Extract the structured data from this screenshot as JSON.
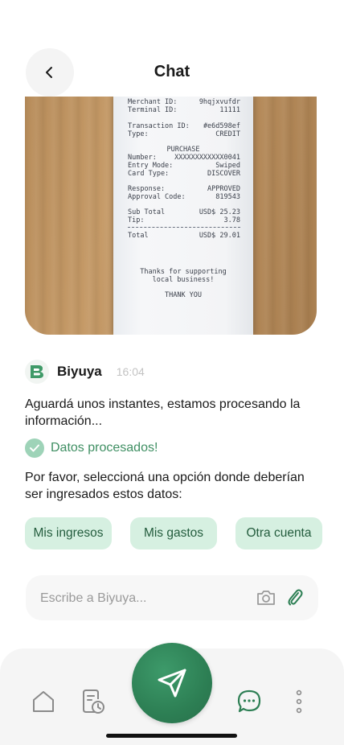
{
  "header": {
    "title": "Chat"
  },
  "receipt": {
    "lines": [
      [
        "Merchant ID:",
        "9hqjxvufdr"
      ],
      [
        "Terminal ID:",
        "11111"
      ],
      [
        "Transaction ID:",
        "#e6d598ef"
      ],
      [
        "Type:",
        "CREDIT"
      ],
      [
        "Number:",
        "XXXXXXXXXXXX0041"
      ],
      [
        "Entry Mode:",
        "Swiped"
      ],
      [
        "Card Type:",
        "DISCOVER"
      ],
      [
        "Response:",
        "APPROVED"
      ],
      [
        "Approval Code:",
        "819543"
      ],
      [
        "Sub Total",
        "USD$ 25.23"
      ],
      [
        "Tip:",
        "3.78"
      ],
      [
        "Total",
        "USD$ 29.01"
      ]
    ],
    "purchase_heading": "PURCHASE",
    "thanks_line1": "Thanks for supporting",
    "thanks_line2": "local business!",
    "thank_you": "THANK YOU"
  },
  "message": {
    "sender": "Biyuya",
    "time": "16:04",
    "processing_text": "Aguardá unos instantes, estamos procesando la información...",
    "processed_text": "Datos procesados!",
    "prompt_text": "Por favor, seleccioná una opción donde deberían ser ingresados estos datos:"
  },
  "options": {
    "income": "Mis ingresos",
    "expenses": "Mis gastos",
    "other_account": "Otra cuenta"
  },
  "composer": {
    "placeholder": "Escribe a Biyuya..."
  },
  "nav": {
    "icons": [
      "home-icon",
      "history-icon",
      "send-icon",
      "chat-icon",
      "more-icon"
    ]
  },
  "colors": {
    "brand_green": "#2d7f54",
    "chip_bg": "#d6f0e1",
    "chip_text": "#235c3d",
    "success_text": "#3f8f63"
  }
}
